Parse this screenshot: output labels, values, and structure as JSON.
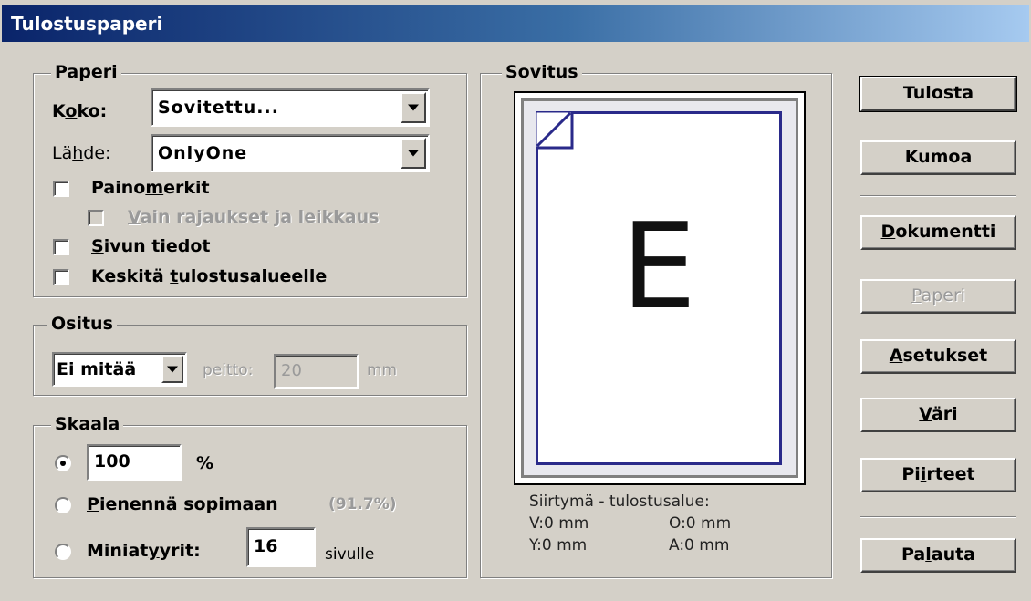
{
  "window": {
    "title": "Tulostuspaperi"
  },
  "paper": {
    "legend": "Paperi",
    "size_label_pre": "K",
    "size_label_ul": "o",
    "size_label_post": "ko:",
    "size_value": "Sovitettu...",
    "source_label_pre": "Lä",
    "source_label_ul": "h",
    "source_label_post": "de:",
    "source_value": "OnlyOne",
    "printer_marks_pre": "Paino",
    "printer_marks_ul": "m",
    "printer_marks_post": "erkit",
    "crop_marks_ul": "V",
    "crop_marks_post": "ain rajaukset ja leikkaus ",
    "page_info_ul": "S",
    "page_info_post": "ivun tiedot",
    "center_pre": "Keskitä ",
    "center_ul": "t",
    "center_post": "ulostusalueelle"
  },
  "tiling": {
    "legend": "Ositus",
    "value": "Ei mitää",
    "overlap_label": "peitto:",
    "overlap_value": "20",
    "overlap_unit": "mm"
  },
  "scale": {
    "legend": "Skaala",
    "percent_value": "100",
    "percent_unit": "%",
    "fit_ul": "P",
    "fit_post": "ienennä sopimaan",
    "fit_percent": "(91.7%)",
    "thumbs_pre": "Miniat",
    "thumbs_ul": "y",
    "thumbs_post": "yrit:",
    "thumbs_value": "16",
    "thumbs_unit": "sivulle"
  },
  "fit_preview": {
    "legend": "Sovitus",
    "preview_letter": "E",
    "offset_title": "Siirtymä - tulostusalue:",
    "v": "V:0 mm",
    "o": "O:0 mm",
    "y": "Y:0 mm",
    "a": "A:0 mm"
  },
  "buttons": {
    "print": "Tulosta",
    "cancel": "Kumoa",
    "document_ul": "D",
    "document_post": "okumentti",
    "paper_ul": "P",
    "paper_post": "aperi",
    "settings_ul": "A",
    "settings_post": "setukset",
    "color_ul": "V",
    "color_post": "äri",
    "features_pre": "Pi",
    "features_ul": "i",
    "features_post": "rteet",
    "reset_pre": "Pa",
    "reset_ul": "l",
    "reset_post": "auta"
  },
  "colors": {
    "page_border": "#2a2a8a",
    "title_start": "#0a246a",
    "title_end": "#a6caf0"
  }
}
